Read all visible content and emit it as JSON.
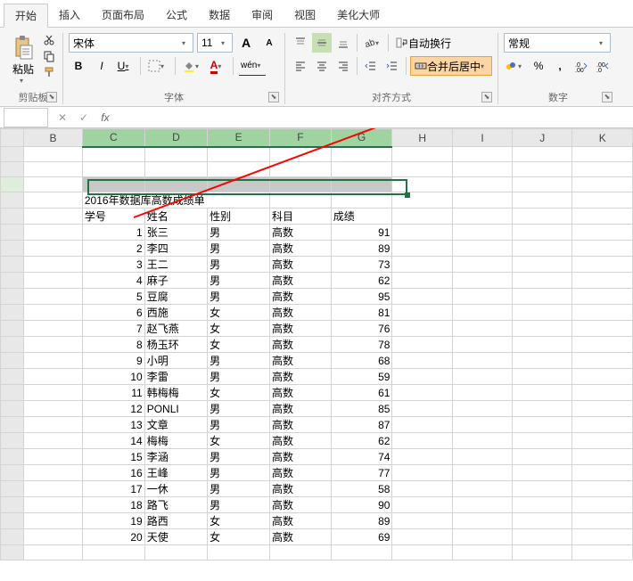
{
  "tabs": [
    "开始",
    "插入",
    "页面布局",
    "公式",
    "数据",
    "审阅",
    "视图",
    "美化大师"
  ],
  "clipboard": {
    "paste": "粘贴",
    "label": "剪贴板"
  },
  "font": {
    "family": "宋体",
    "size": "11",
    "grow": "A",
    "shrink": "A",
    "bold": "B",
    "italic": "I",
    "underline": "U",
    "label": "字体",
    "pinyin": "wén"
  },
  "alignment": {
    "wrap": "自动换行",
    "merge": "合并后居中",
    "label": "对齐方式"
  },
  "number": {
    "format": "常规",
    "label": "数字",
    "percent": "%",
    "comma": ","
  },
  "columns": [
    "B",
    "C",
    "D",
    "E",
    "F",
    "G",
    "H",
    "I",
    "J",
    "K"
  ],
  "sheet": {
    "title": "2016年数据库高数成绩单",
    "headers": {
      "id": "学号",
      "name": "姓名",
      "gender": "性别",
      "subject": "科目",
      "score": "成绩"
    },
    "rows": [
      {
        "id": 1,
        "name": "张三",
        "gender": "男",
        "subject": "高数",
        "score": 91
      },
      {
        "id": 2,
        "name": "李四",
        "gender": "男",
        "subject": "高数",
        "score": 89
      },
      {
        "id": 3,
        "name": "王二",
        "gender": "男",
        "subject": "高数",
        "score": 73
      },
      {
        "id": 4,
        "name": "麻子",
        "gender": "男",
        "subject": "高数",
        "score": 62
      },
      {
        "id": 5,
        "name": "豆腐",
        "gender": "男",
        "subject": "高数",
        "score": 95
      },
      {
        "id": 6,
        "name": "西施",
        "gender": "女",
        "subject": "高数",
        "score": 81
      },
      {
        "id": 7,
        "name": "赵飞燕",
        "gender": "女",
        "subject": "高数",
        "score": 76
      },
      {
        "id": 8,
        "name": "杨玉环",
        "gender": "女",
        "subject": "高数",
        "score": 78
      },
      {
        "id": 9,
        "name": "小明",
        "gender": "男",
        "subject": "高数",
        "score": 68
      },
      {
        "id": 10,
        "name": "李雷",
        "gender": "男",
        "subject": "高数",
        "score": 59
      },
      {
        "id": 11,
        "name": "韩梅梅",
        "gender": "女",
        "subject": "高数",
        "score": 61
      },
      {
        "id": 12,
        "name": "PONLI",
        "gender": "男",
        "subject": "高数",
        "score": 85
      },
      {
        "id": 13,
        "name": "文章",
        "gender": "男",
        "subject": "高数",
        "score": 87
      },
      {
        "id": 14,
        "name": "梅梅",
        "gender": "女",
        "subject": "高数",
        "score": 62
      },
      {
        "id": 15,
        "name": "李涵",
        "gender": "男",
        "subject": "高数",
        "score": 74
      },
      {
        "id": 16,
        "name": "王峰",
        "gender": "男",
        "subject": "高数",
        "score": 77
      },
      {
        "id": 17,
        "name": "一休",
        "gender": "男",
        "subject": "高数",
        "score": 58
      },
      {
        "id": 18,
        "name": "路飞",
        "gender": "男",
        "subject": "高数",
        "score": 90
      },
      {
        "id": 19,
        "name": "路西",
        "gender": "女",
        "subject": "高数",
        "score": 89
      },
      {
        "id": 20,
        "name": "天使",
        "gender": "女",
        "subject": "高数",
        "score": 69
      }
    ]
  }
}
